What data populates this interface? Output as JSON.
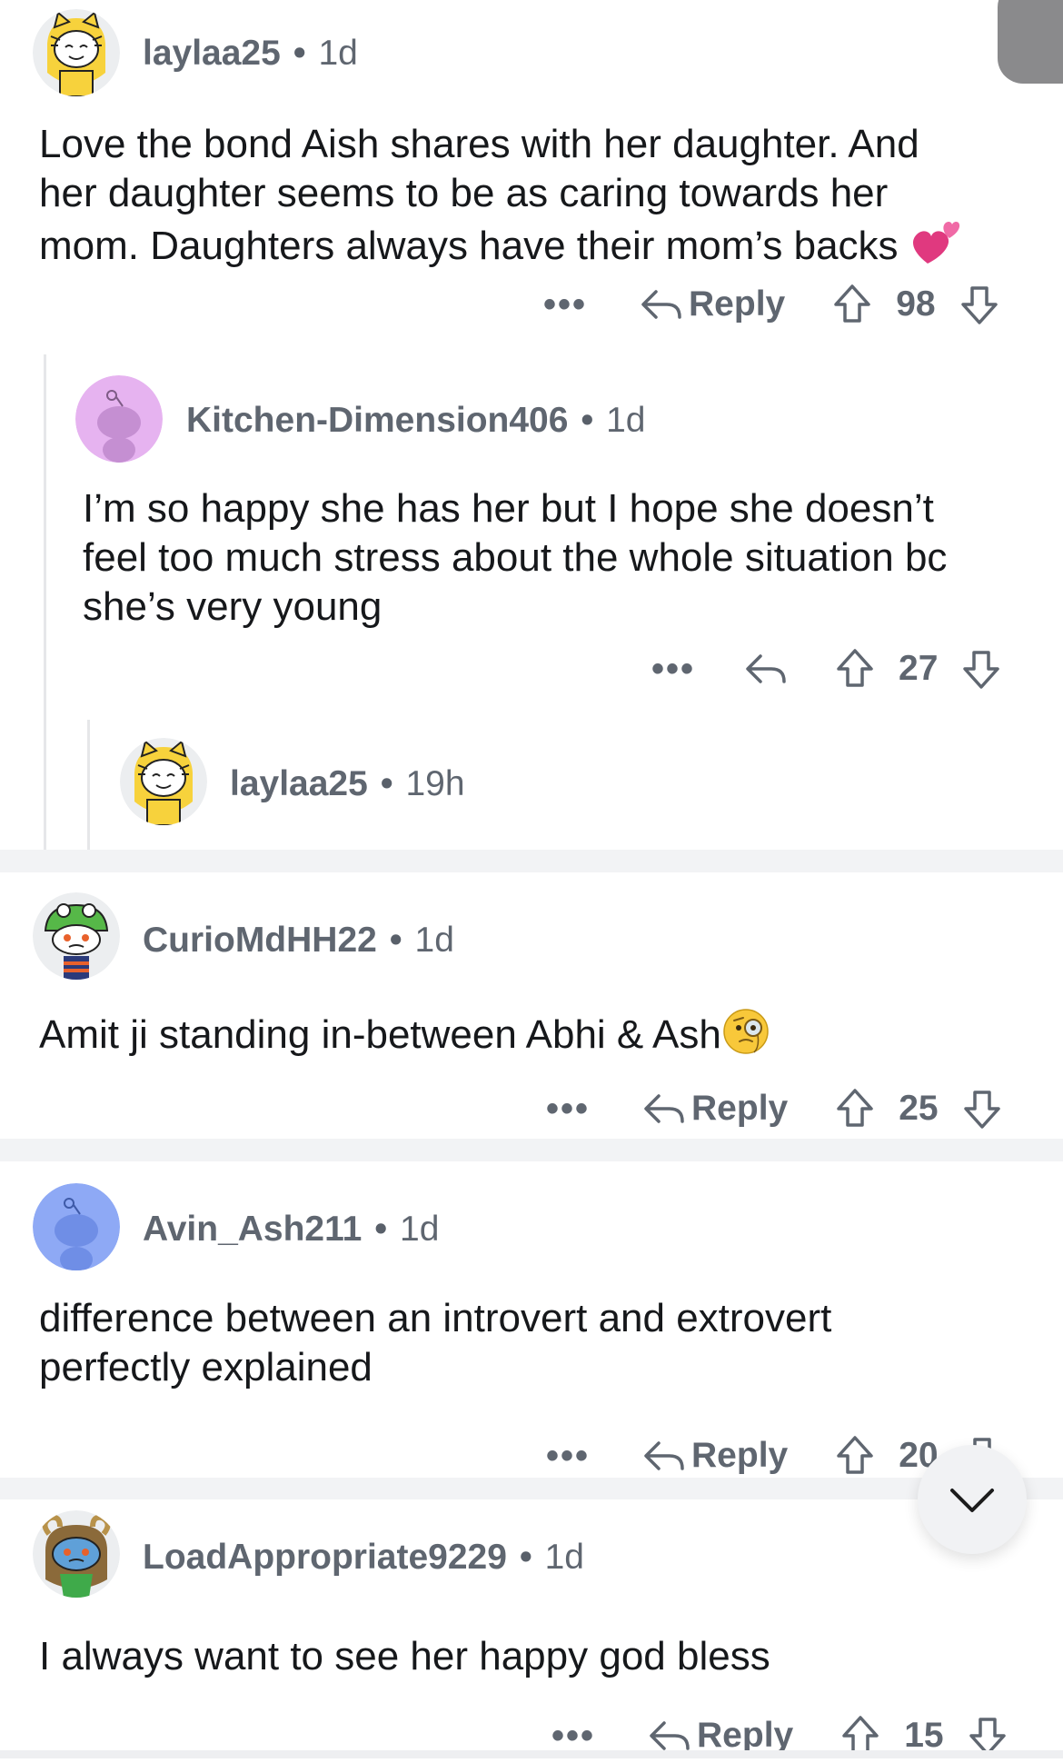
{
  "colors": {
    "separator": "#f2f3f5",
    "meta_text": "#5f6670",
    "body_text": "#16181b",
    "love_heart": "#e0397f",
    "avatar_purple": "#e6b3f0",
    "avatar_blue": "#8ea9f5"
  },
  "comments": [
    {
      "username": "laylaa25",
      "age": "1d",
      "avatar": "tiger-hood-avatar",
      "lines": [
        "Love the bond Aish shares with her daughter. And",
        "her daughter seems to be as caring towards her",
        "mom. Daughters always have their mom’s backs"
      ],
      "emoji": "two-hearts-emoji",
      "more": "•••",
      "reply_label": "Reply",
      "score": "98"
    },
    {
      "username": "Kitchen-Dimension406",
      "age": "1d",
      "avatar": "default-snoo-avatar",
      "lines": [
        "I’m so happy she has her but I hope she doesn’t",
        "feel too much stress about the whole situation bc",
        "she’s very young"
      ],
      "more": "•••",
      "score": "27"
    },
    {
      "username": "laylaa25",
      "age": "19h",
      "avatar": "tiger-hood-avatar"
    },
    {
      "username": "CurioMdHH22",
      "age": "1d",
      "avatar": "frog-hat-snoo-avatar",
      "lines": [
        "Amit ji standing in-between Abhi & Ash"
      ],
      "emoji": "face-with-monocle-emoji",
      "more": "•••",
      "reply_label": "Reply",
      "score": "25"
    },
    {
      "username": "Avin_Ash211",
      "age": "1d",
      "avatar": "default-snoo-avatar",
      "lines": [
        "difference between an introvert and extrovert",
        "perfectly explained"
      ],
      "more": "•••",
      "reply_label": "Reply",
      "score": "20"
    },
    {
      "username": "LoadAppropriate9229",
      "age": "1d",
      "avatar": "ram-horns-snoo-avatar",
      "lines": [
        "I always want to see her happy god bless"
      ],
      "more": "•••",
      "reply_label": "Reply",
      "score": "15"
    }
  ],
  "floating": {
    "scroll_icon": "chevron-down-icon"
  }
}
